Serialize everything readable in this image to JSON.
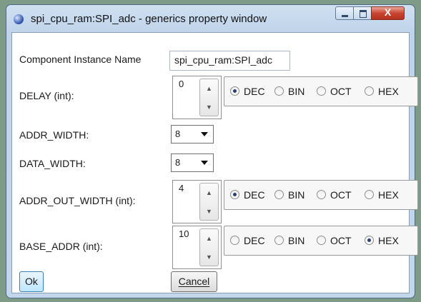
{
  "window": {
    "title": "spi_cpu_ram:SPI_adc - generics property window",
    "close_glyph": "X"
  },
  "fields": {
    "component_instance_name": {
      "label": "Component Instance Name",
      "value": "spi_cpu_ram:SPI_adc"
    },
    "delay": {
      "label": "DELAY (int):",
      "value": "0",
      "radios": [
        {
          "label": "DEC",
          "checked": true
        },
        {
          "label": "BIN",
          "checked": false
        },
        {
          "label": "OCT",
          "checked": false
        },
        {
          "label": "HEX",
          "checked": false
        }
      ]
    },
    "addr_width": {
      "label": "ADDR_WIDTH:",
      "value": "8"
    },
    "data_width": {
      "label": "DATA_WIDTH:",
      "value": "8"
    },
    "addr_out_width": {
      "label": "ADDR_OUT_WIDTH (int):",
      "value": "4",
      "radios": [
        {
          "label": "DEC",
          "checked": true
        },
        {
          "label": "BIN",
          "checked": false
        },
        {
          "label": "OCT",
          "checked": false
        },
        {
          "label": "HEX",
          "checked": false
        }
      ]
    },
    "base_addr": {
      "label": "BASE_ADDR (int):",
      "value": "10",
      "radios": [
        {
          "label": "DEC",
          "checked": false
        },
        {
          "label": "BIN",
          "checked": false
        },
        {
          "label": "OCT",
          "checked": false
        },
        {
          "label": "HEX",
          "checked": true
        }
      ]
    }
  },
  "buttons": {
    "ok": "Ok",
    "cancel": "Cancel"
  },
  "icons": {
    "app": "app-globe-icon",
    "minimize": "minimize-icon",
    "maximize": "maximize-icon",
    "close": "close-icon",
    "spin_up": "spin-up-icon",
    "spin_down": "spin-down-icon",
    "dropdown": "chevron-down-icon"
  }
}
